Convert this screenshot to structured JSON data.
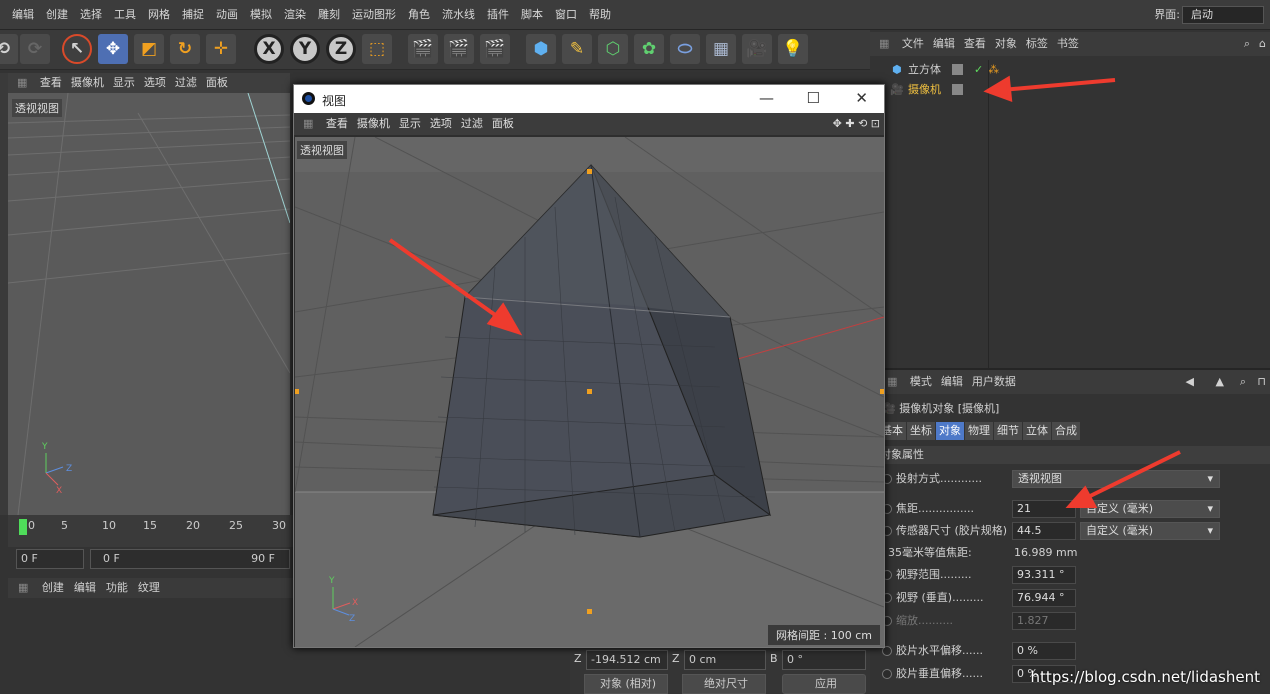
{
  "menubar": {
    "items": [
      "编辑",
      "创建",
      "选择",
      "工具",
      "网格",
      "捕捉",
      "动画",
      "模拟",
      "渲染",
      "雕刻",
      "运动图形",
      "角色",
      "流水线",
      "插件",
      "脚本",
      "窗口",
      "帮助"
    ],
    "layout_label": "界面:",
    "layout_value": "启动"
  },
  "toolbar": {
    "axis_x": "X",
    "axis_y": "Y",
    "axis_z": "Z"
  },
  "left_view": {
    "menu": [
      "查看",
      "摄像机",
      "显示",
      "选项",
      "过滤",
      "面板"
    ],
    "label": "透视视图"
  },
  "timeline": {
    "ticks": [
      "0",
      "5",
      "10",
      "15",
      "20",
      "25",
      "30"
    ],
    "frame_start": "0 F",
    "range_start": "0 F",
    "range_end": "90 F"
  },
  "materials": {
    "menu": [
      "创建",
      "编辑",
      "功能",
      "纹理"
    ]
  },
  "float_window": {
    "title": "视图",
    "menu": [
      "查看",
      "摄像机",
      "显示",
      "选项",
      "过滤",
      "面板"
    ],
    "label": "透视视图",
    "grid_info": "网格间距 : 100 cm"
  },
  "object_manager": {
    "menu": [
      "文件",
      "编辑",
      "查看",
      "对象",
      "标签",
      "书签"
    ],
    "objects": [
      {
        "name": "立方体",
        "color": "#d0d0d0"
      },
      {
        "name": "摄像机",
        "color": "#f0c040"
      }
    ]
  },
  "attribute_manager": {
    "menu": [
      "模式",
      "编辑",
      "用户数据"
    ],
    "object_title": "摄像机对象 [摄像机]",
    "tabs": [
      "基本",
      "坐标",
      "对象",
      "物理",
      "细节",
      "立体",
      "合成"
    ],
    "active_tab": "对象",
    "section": "对象属性",
    "properties": {
      "projection_label": "投射方式............",
      "projection_value": "透视视图",
      "focal_label": "焦距................",
      "focal_value": "21",
      "focal_unit": "自定义 (毫米)",
      "sensor_label": "传感器尺寸 (胶片规格)",
      "sensor_value": "44.5",
      "sensor_unit": "自定义 (毫米)",
      "equiv_label": "35毫米等值焦距:",
      "equiv_value": "16.989 mm",
      "fov_label": "视野范围.........",
      "fov_value": "93.311 °",
      "fov_v_label": "视野 (垂直).........",
      "fov_v_value": "76.944 °",
      "zoom_label": "缩放..........",
      "zoom_value": "1.827",
      "film_h_label": "胶片水平偏移......",
      "film_h_value": "0 %",
      "film_v_label": "胶片垂直偏移......",
      "film_v_value": "0 %"
    }
  },
  "coords": {
    "z_label": "Z",
    "z_pos": "-194.512 cm",
    "z2_label": "Z",
    "z_size": "0 cm",
    "b_label": "B",
    "b_rot": "0 °",
    "mode": "对象 (相对)",
    "size_mode": "绝对尺寸",
    "apply": "应用"
  },
  "watermark": "https://blog.csdn.net/lidashent"
}
